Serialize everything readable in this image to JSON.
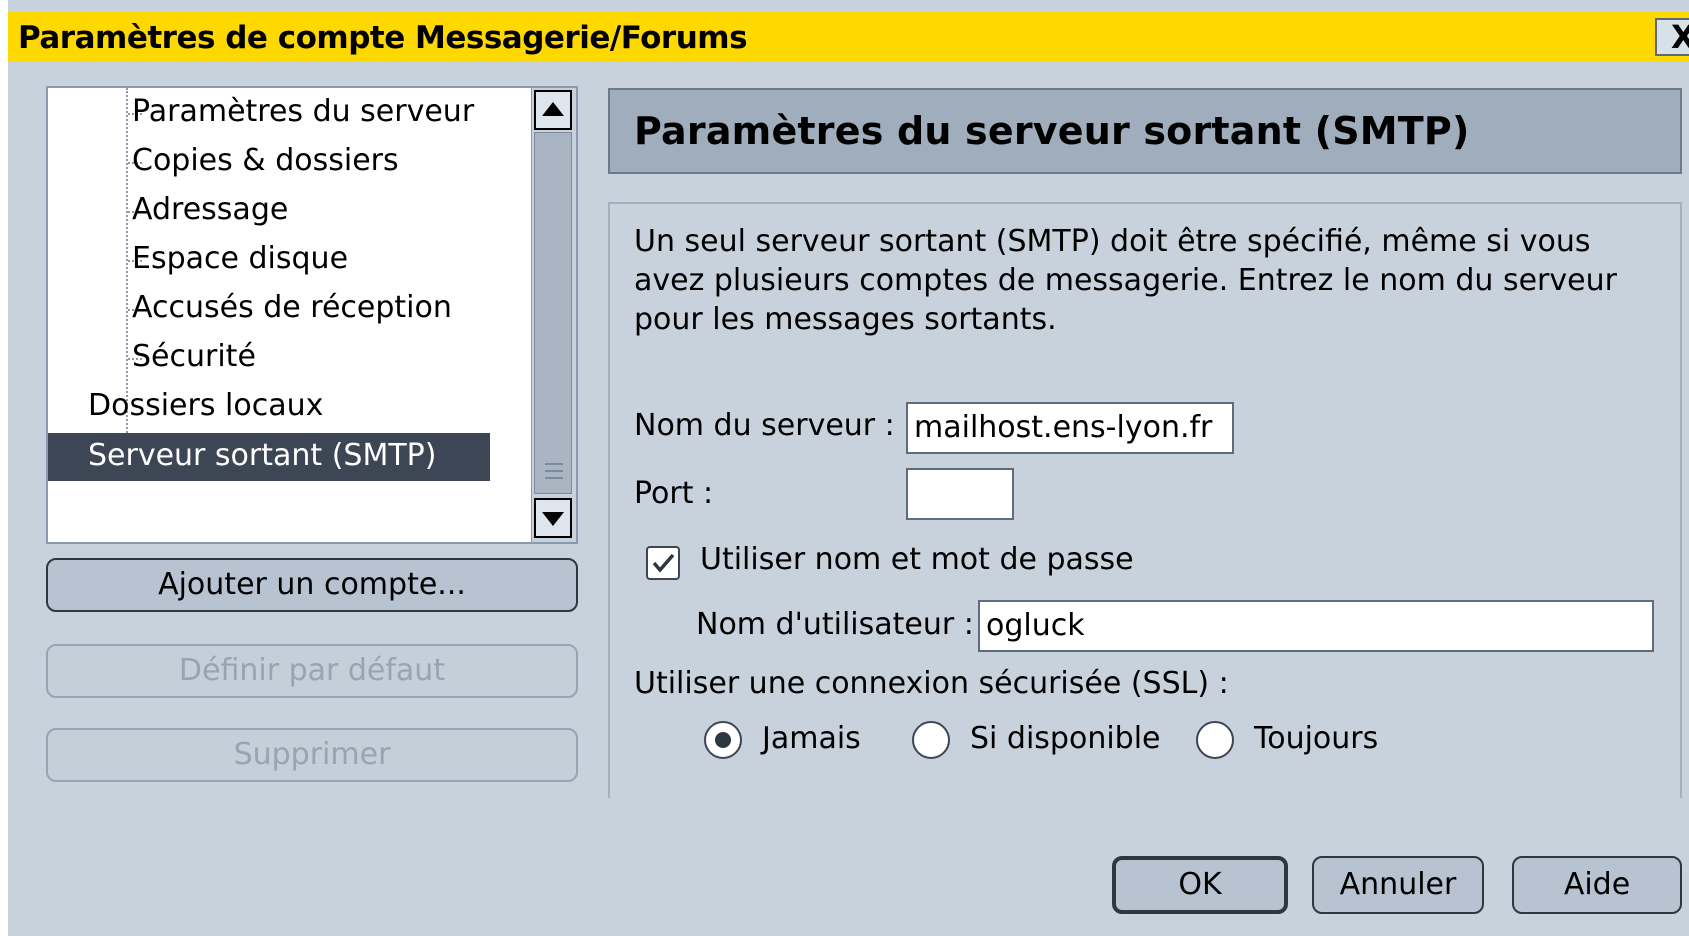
{
  "window": {
    "title": "Paramètres de compte Messagerie/Forums",
    "close_label": "X"
  },
  "tree": {
    "items": [
      {
        "label": "Paramètres du serveur",
        "level": 1
      },
      {
        "label": "Copies & dossiers",
        "level": 1
      },
      {
        "label": "Adressage",
        "level": 1
      },
      {
        "label": "Espace disque",
        "level": 1
      },
      {
        "label": "Accusés de réception",
        "level": 1
      },
      {
        "label": "Sécurité",
        "level": 1
      },
      {
        "label": "Dossiers locaux",
        "level": 0
      },
      {
        "label": "Serveur sortant (SMTP)",
        "level": 0,
        "selected": true
      }
    ]
  },
  "left_buttons": {
    "add_account": "Ajouter un compte...",
    "set_default": "Définir par défaut",
    "delete": "Supprimer"
  },
  "panel": {
    "header": "Paramètres du serveur sortant (SMTP)",
    "description": "Un seul serveur sortant (SMTP) doit être spécifié, même si vous avez plusieurs comptes de messagerie. Entrez le nom du serveur pour les messages sortants.",
    "server_name_label": "Nom du serveur :",
    "server_name_value": "mailhost.ens-lyon.fr",
    "port_label": "Port :",
    "port_value": "",
    "use_auth_label": "Utiliser nom et mot de passe",
    "use_auth_checked": true,
    "username_label": "Nom d'utilisateur :",
    "username_value": "ogluck",
    "ssl_label": "Utiliser une connexion sécurisée (SSL) :",
    "ssl_options": [
      "Jamais",
      "Si disponible",
      "Toujours"
    ],
    "ssl_selected": "Jamais"
  },
  "dialog_buttons": {
    "ok": "OK",
    "cancel": "Annuler",
    "help": "Aide"
  },
  "colors": {
    "titlebar": "#ffd800",
    "background": "#c8d2dc",
    "selection": "#3c4654"
  }
}
